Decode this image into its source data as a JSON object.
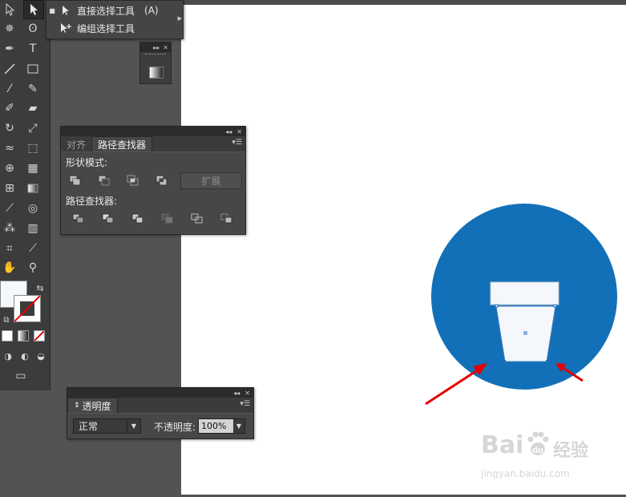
{
  "flyout": {
    "items": [
      {
        "label": "直接选择工具",
        "shortcut": "(A)",
        "icon": "direct-selection-arrow-icon",
        "selected": true
      },
      {
        "label": "编组选择工具",
        "shortcut": "",
        "icon": "group-selection-arrow-icon",
        "selected": false
      }
    ]
  },
  "pathfinder_panel": {
    "tabs": [
      {
        "label": "对齐",
        "active": false
      },
      {
        "label": "路径查找器",
        "active": true
      }
    ],
    "shape_modes_label": "形状模式:",
    "expand_label": "扩展",
    "pathfinders_label": "路径查找器:"
  },
  "transparency_panel": {
    "title": "透明度",
    "blend_mode": "正常",
    "opacity_label": "不透明度:",
    "opacity_value": "100%"
  },
  "canvas": {
    "circle_color": "#1270b8",
    "shape_fill": "#f4f8fc",
    "arrow_color": "#e60000"
  },
  "watermark": {
    "brand": "Bai",
    "brand_cn": "经验",
    "url": "jingyan.baidu.com"
  },
  "colors": {
    "ui_dark": "#3c3c3c",
    "ui_panel": "#474747",
    "workspace": "#535353"
  }
}
